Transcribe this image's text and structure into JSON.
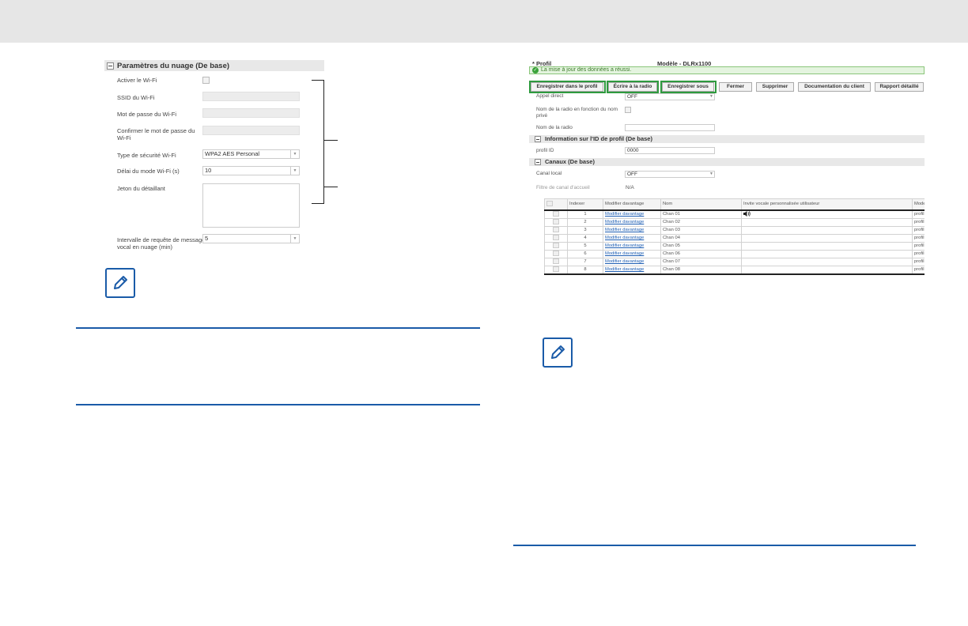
{
  "left_panel": {
    "section_title": "Paramètres du nuage (De base)",
    "fields": {
      "wifi_enable": "Activer le Wi-Fi",
      "ssid": "SSID du Wi-Fi",
      "password": "Mot de passe du Wi-Fi",
      "confirm_password": "Confirmer le mot de passe du Wi-Fi",
      "security_type": "Type de sécurité Wi-Fi",
      "security_type_value": "WPA2 AES Personal",
      "wifi_mode_delay": "Délai du mode Wi-Fi (s)",
      "wifi_mode_delay_value": "10",
      "dealer_token": "Jeton du détaillant",
      "voicemail_interval": "Intervalle de requête de message vocal en nuage (min)",
      "voicemail_interval_value": "5"
    }
  },
  "right_panel": {
    "profile_label": "* Profil",
    "model_label": "Modèle - DLRx1100",
    "success_banner": "La mise à jour des données a réussi.",
    "toolbar": {
      "save_profile": "Enregistrer dans le profil",
      "write_radio": "Écrire à la radio",
      "save_as": "Enregistrer sous",
      "close": "Fermer",
      "delete": "Supprimer",
      "client_doc": "Documentation du client",
      "detailed_report": "Rapport détaillé"
    },
    "fields": {
      "direct_call": "Appel direct",
      "direct_call_value": "OFF",
      "radio_name_private": "Nom de la radio en fonction du nom privé",
      "radio_name": "Nom de la radio",
      "profile_id_section": "Information sur l'ID de profil (De base)",
      "profile_id": "profil ID",
      "profile_id_value": "0000",
      "channels_section": "Canaux (De base)",
      "local_channel": "Canal local",
      "local_channel_value": "OFF",
      "home_channel_filter": "Filtre de canal d'accueil",
      "home_channel_filter_value": "N/A"
    },
    "table": {
      "headers": [
        "",
        "Indexer",
        "Modifier davantage",
        "Nom",
        "Invite vocale personnalisée utilisateur",
        "Mode"
      ],
      "rows": [
        {
          "index": "1",
          "link": "Modifier davantage",
          "name": "Chan 01",
          "mode": "profil"
        },
        {
          "index": "2",
          "link": "Modifier davantage",
          "name": "Chan 02",
          "mode": "profil"
        },
        {
          "index": "3",
          "link": "Modifier davantage",
          "name": "Chan 03",
          "mode": "profil"
        },
        {
          "index": "4",
          "link": "Modifier davantage",
          "name": "Chan 04",
          "mode": "profil"
        },
        {
          "index": "5",
          "link": "Modifier davantage",
          "name": "Chan 05",
          "mode": "profil"
        },
        {
          "index": "6",
          "link": "Modifier davantage",
          "name": "Chan 06",
          "mode": "profil"
        },
        {
          "index": "7",
          "link": "Modifier davantage",
          "name": "Chan 07",
          "mode": "profil"
        },
        {
          "index": "8",
          "link": "Modifier davantage",
          "name": "Chan 08",
          "mode": "profil"
        }
      ]
    }
  },
  "icons": [
    "note-pencil-icon",
    "speaker-icon",
    "check-circle-icon"
  ],
  "colors": {
    "accent_blue": "#1a5ba8",
    "highlight_green": "#2e9a3e"
  }
}
